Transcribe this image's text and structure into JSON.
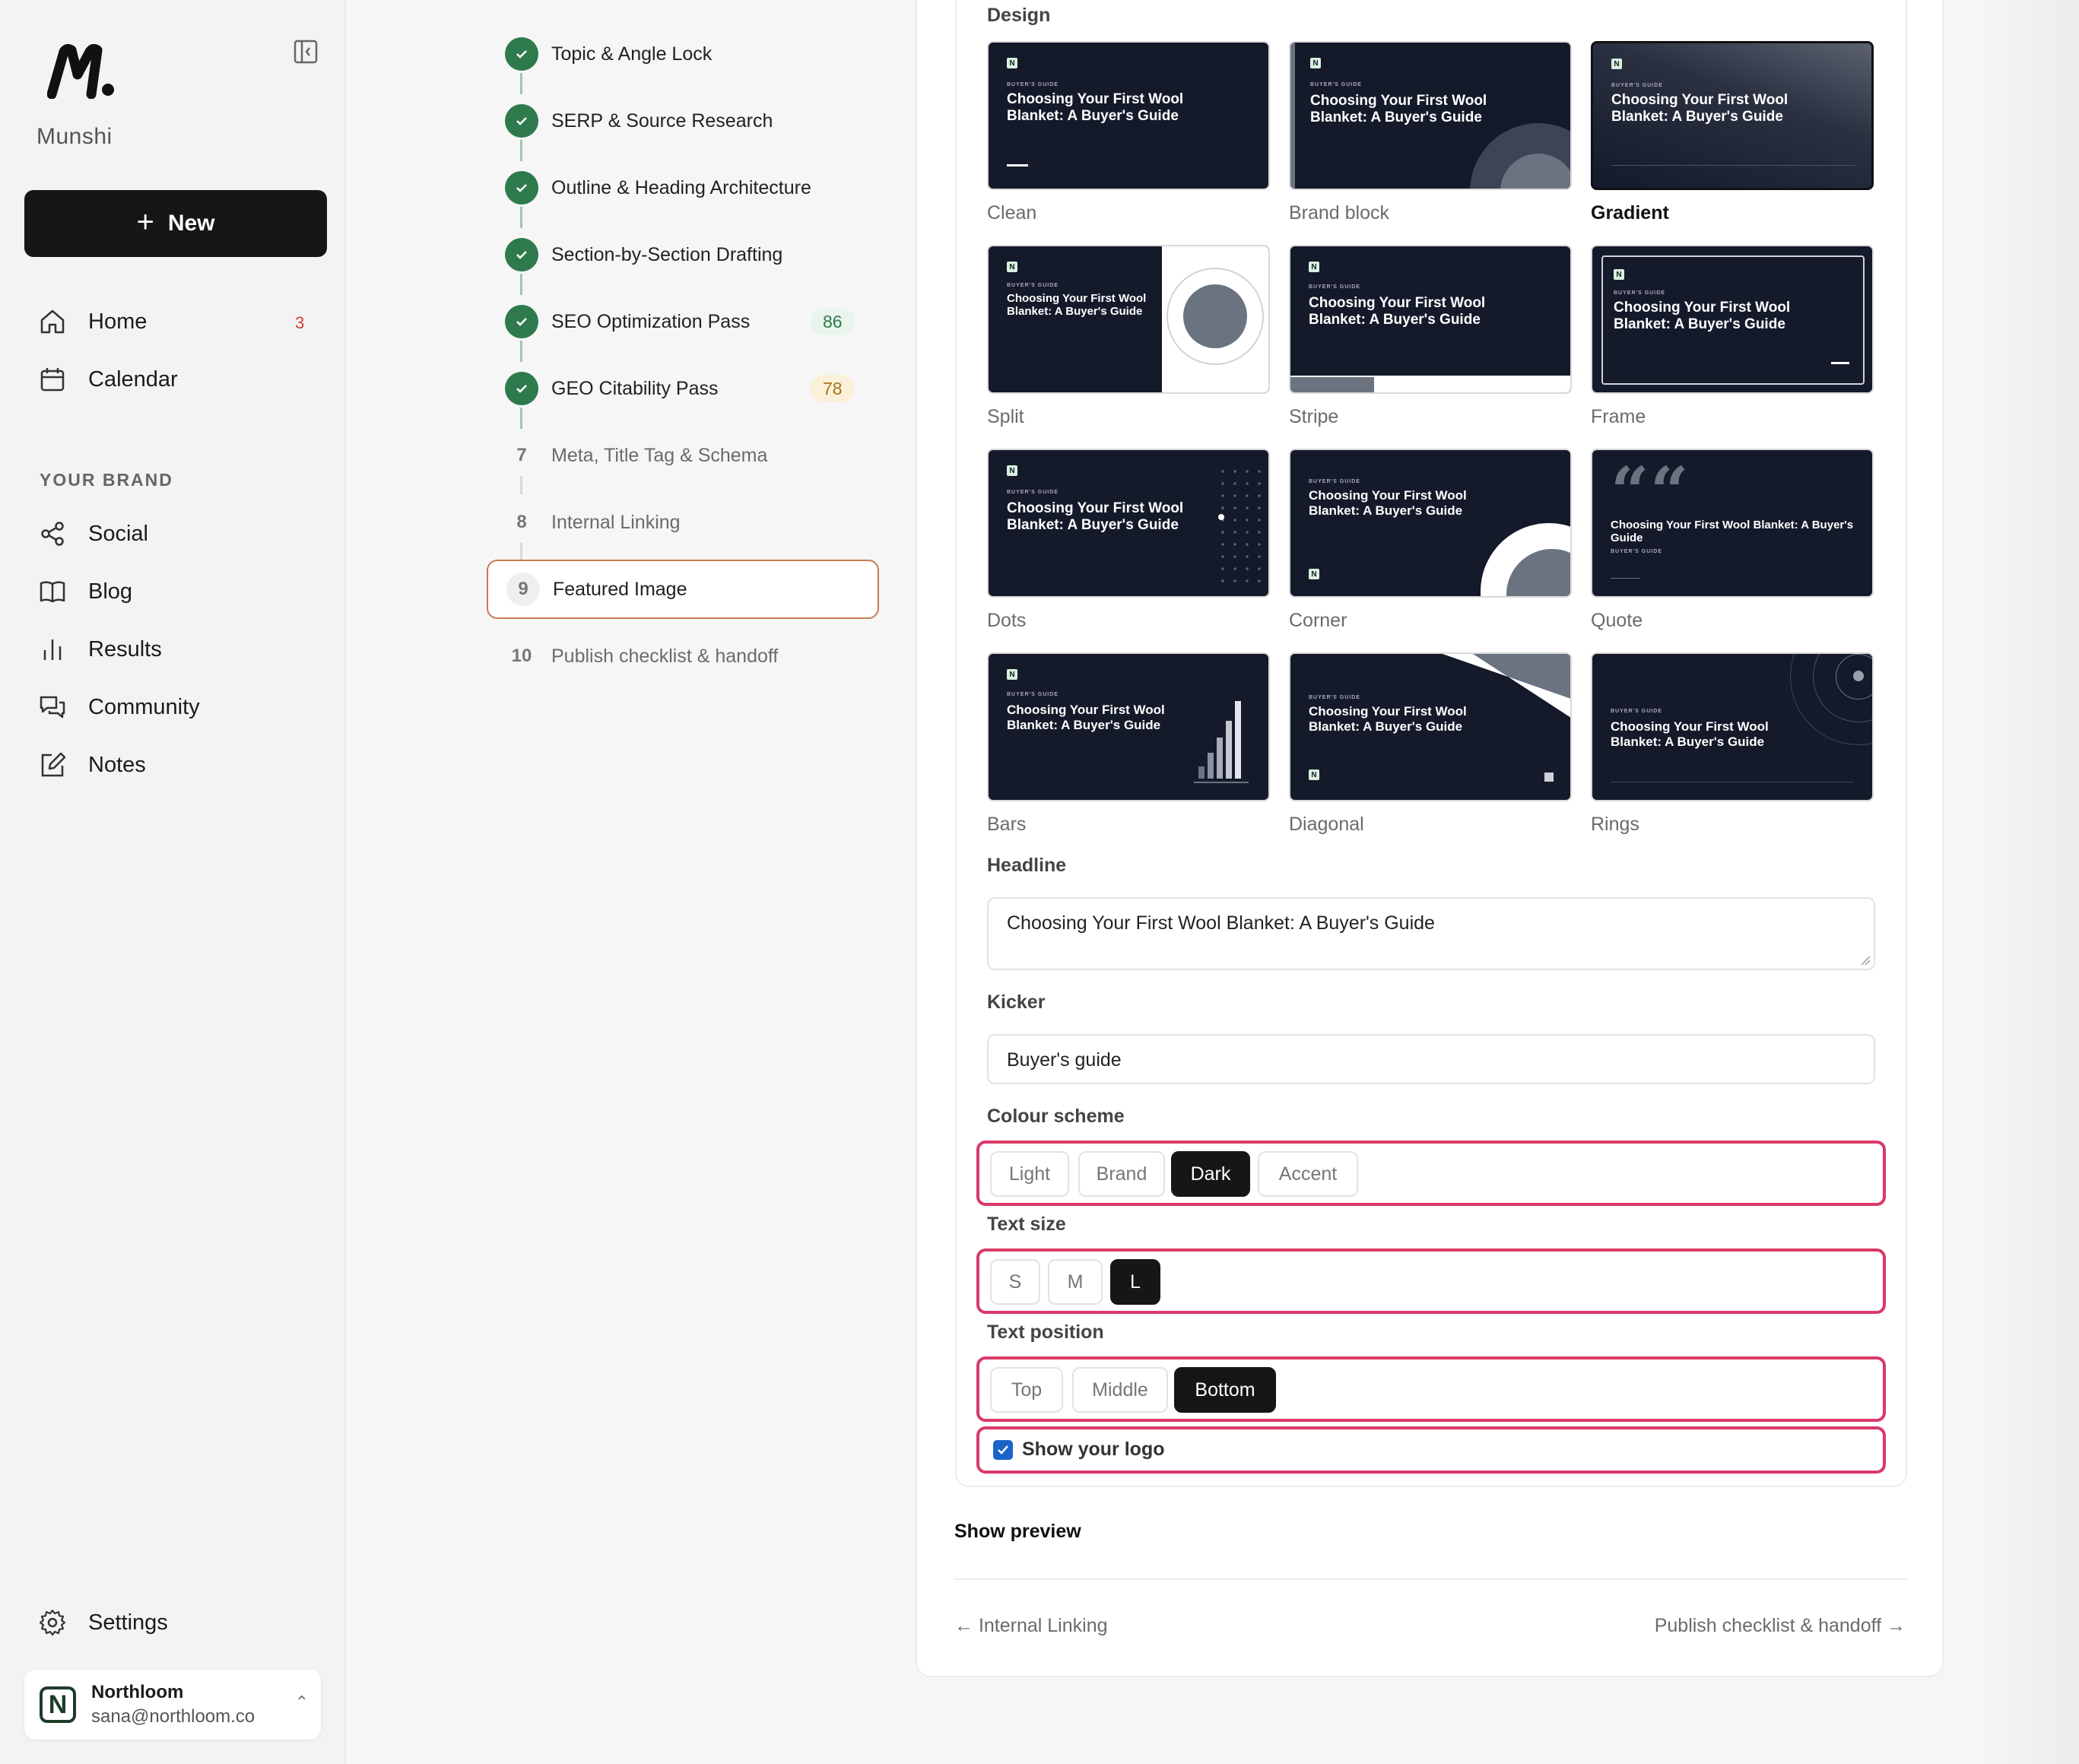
{
  "brand": {
    "name": "Munshi"
  },
  "sidebar": {
    "new_label": "New",
    "nav": [
      {
        "label": "Home",
        "badge": "3"
      },
      {
        "label": "Calendar"
      }
    ],
    "section_title": "YOUR BRAND",
    "brand_nav": [
      {
        "label": "Social"
      },
      {
        "label": "Blog"
      },
      {
        "label": "Results"
      },
      {
        "label": "Community"
      },
      {
        "label": "Notes"
      }
    ],
    "settings_label": "Settings",
    "account": {
      "initial": "N",
      "name": "Northloom",
      "email": "sana@northloom.co"
    }
  },
  "steps": [
    {
      "label": "Topic & Angle Lock",
      "status": "done"
    },
    {
      "label": "SERP & Source Research",
      "status": "done"
    },
    {
      "label": "Outline & Heading Architecture",
      "status": "done"
    },
    {
      "label": "Section-by-Section Drafting",
      "status": "done"
    },
    {
      "label": "SEO Optimization Pass",
      "status": "done",
      "score": "86"
    },
    {
      "label": "GEO Citability Pass",
      "status": "done",
      "score": "78"
    },
    {
      "number": "7",
      "label": "Meta, Title Tag & Schema",
      "status": "pending"
    },
    {
      "number": "8",
      "label": "Internal Linking",
      "status": "pending"
    },
    {
      "number": "9",
      "label": "Featured Image",
      "status": "active"
    },
    {
      "number": "10",
      "label": "Publish checklist & handoff",
      "status": "pending"
    }
  ],
  "editor": {
    "design_label": "Design",
    "card_kicker": "BUYER'S GUIDE",
    "card_title": "Choosing Your First Wool Blanket: A Buyer's Guide",
    "card_logo": "N",
    "designs": [
      {
        "name": "Clean"
      },
      {
        "name": "Brand block"
      },
      {
        "name": "Gradient",
        "selected": true
      },
      {
        "name": "Split"
      },
      {
        "name": "Stripe"
      },
      {
        "name": "Frame"
      },
      {
        "name": "Dots"
      },
      {
        "name": "Corner"
      },
      {
        "name": "Quote"
      },
      {
        "name": "Bars"
      },
      {
        "name": "Diagonal"
      },
      {
        "name": "Rings"
      }
    ],
    "headline_label": "Headline",
    "headline_value": "Choosing Your First Wool Blanket: A Buyer's Guide",
    "kicker_label": "Kicker",
    "kicker_value": "Buyer's guide",
    "colour_label": "Colour scheme",
    "colour_options": [
      "Light",
      "Brand",
      "Dark",
      "Accent"
    ],
    "colour_selected": "Dark",
    "size_label": "Text size",
    "size_options": [
      "S",
      "M",
      "L"
    ],
    "size_selected": "L",
    "position_label": "Text position",
    "position_options": [
      "Top",
      "Middle",
      "Bottom"
    ],
    "position_selected": "Bottom",
    "logo_label": "Show your logo",
    "logo_checked": true,
    "preview_label": "Show preview",
    "prev_label": "← Internal Linking",
    "next_label": "Publish checklist & handoff →"
  },
  "colors": {
    "accent_highlight": "#d93a68",
    "done_green": "#2f7a4d",
    "card_bg": "#141a2a"
  }
}
